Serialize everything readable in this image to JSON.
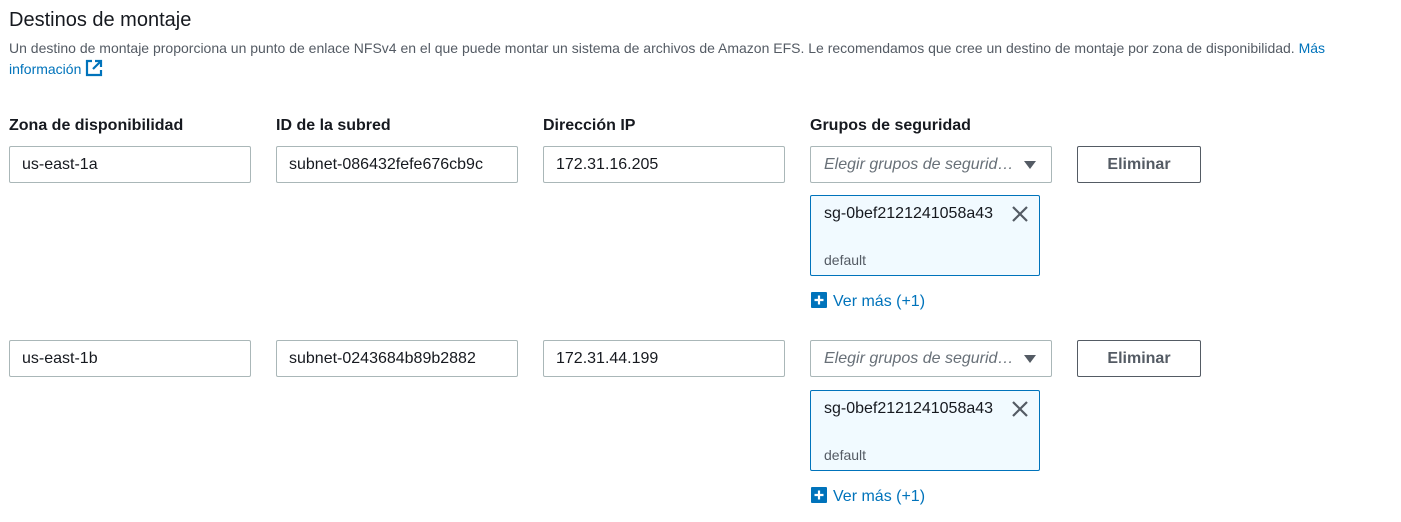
{
  "section": {
    "title": "Destinos de montaje",
    "description": "Un destino de montaje proporciona un punto de enlace NFSv4 en el que puede montar un sistema de archivos de Amazon EFS. Le recomendamos que cree un destino de montaje por zona de disponibilidad.",
    "more_info_link": "Más información"
  },
  "columns": {
    "az": "Zona de disponibilidad",
    "subnet": "ID de la subred",
    "ip": "Dirección IP",
    "security_groups": "Grupos de seguridad"
  },
  "rows": [
    {
      "az": "us-east-1a",
      "subnet": "subnet-086432fefe676cb9c",
      "ip": "172.31.16.205",
      "sg_placeholder": "Elegir grupos de seguridad",
      "token_name": "sg-0bef2121241058a43",
      "token_desc": "default",
      "remove_label": "Eliminar",
      "more_label": "Ver más (+1)"
    },
    {
      "az": "us-east-1b",
      "subnet": "subnet-0243684b89b2882",
      "ip": "172.31.44.199",
      "sg_placeholder": "Elegir grupos de seguridad",
      "token_name": "sg-0bef2121241058a43",
      "token_desc": "default",
      "remove_label": "Eliminar",
      "more_label": "Ver más (+1)"
    }
  ],
  "icons": {
    "external_link": "external-link-icon",
    "dropdown": "caret-down-icon",
    "dismiss": "close-icon",
    "show_more": "plus-square-icon"
  },
  "colors": {
    "link": "#0073bb",
    "token_bg": "#f1faff",
    "token_border": "#0073bb",
    "input_border": "#aab7b8",
    "button_border": "#545b64"
  }
}
